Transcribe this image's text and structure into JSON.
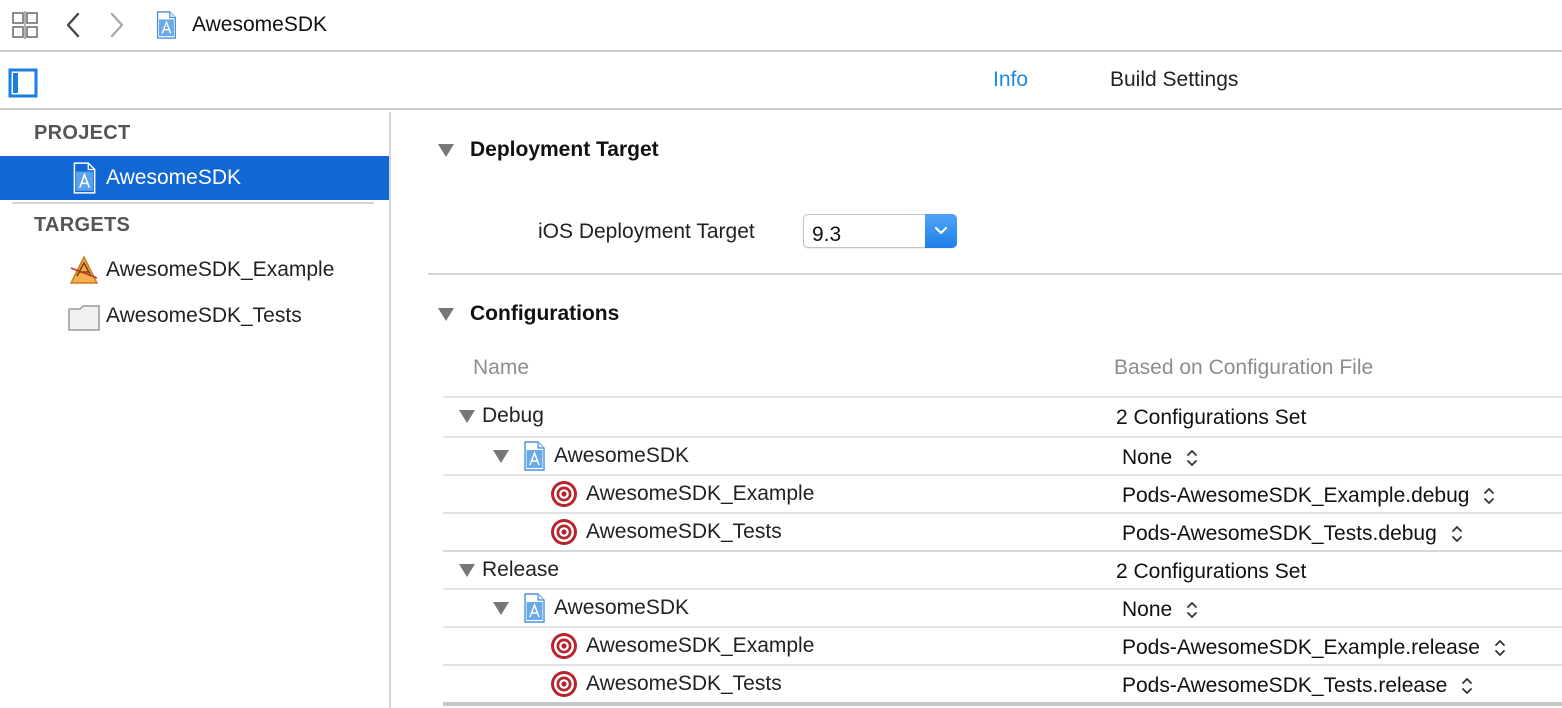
{
  "toolbar": {
    "breadcrumb_title": "AwesomeSDK"
  },
  "tabs": {
    "info": "Info",
    "build_settings": "Build Settings",
    "active": "info",
    "active_color": "#1a8be5"
  },
  "sidebar": {
    "project_header": "PROJECT",
    "project_item": "AwesomeSDK",
    "targets_header": "TARGETS",
    "targets": [
      {
        "label": "AwesomeSDK_Example",
        "icon": "app-target-icon"
      },
      {
        "label": "AwesomeSDK_Tests",
        "icon": "test-bundle-icon"
      }
    ],
    "selected_color": "#1167d3"
  },
  "deployment": {
    "title": "Deployment Target",
    "field_label": "iOS Deployment Target",
    "value": "9.3"
  },
  "configurations": {
    "title": "Configurations",
    "col_name": "Name",
    "col_file": "Based on Configuration File",
    "groups": [
      {
        "name": "Debug",
        "summary": "2 Configurations Set",
        "project": {
          "name": "AwesomeSDK",
          "file": "None"
        },
        "targets": [
          {
            "name": "AwesomeSDK_Example",
            "file": "Pods-AwesomeSDK_Example.debug"
          },
          {
            "name": "AwesomeSDK_Tests",
            "file": "Pods-AwesomeSDK_Tests.debug"
          }
        ]
      },
      {
        "name": "Release",
        "summary": "2 Configurations Set",
        "project": {
          "name": "AwesomeSDK",
          "file": "None"
        },
        "targets": [
          {
            "name": "AwesomeSDK_Example",
            "file": "Pods-AwesomeSDK_Example.release"
          },
          {
            "name": "AwesomeSDK_Tests",
            "file": "Pods-AwesomeSDK_Tests.release"
          }
        ]
      }
    ]
  }
}
